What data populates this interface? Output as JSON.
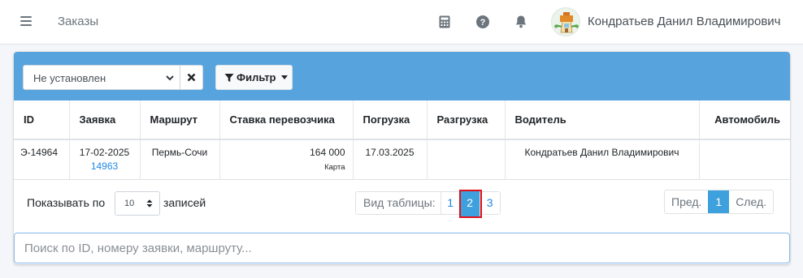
{
  "navbar": {
    "title": "Заказы",
    "user_name": "Кондратьев Данил Владимирович",
    "icons": [
      "menu-icon",
      "calculator-icon",
      "help-icon",
      "bell-icon"
    ]
  },
  "filters": {
    "status_value": "Не установлен",
    "filter_label": "Фильтр"
  },
  "table": {
    "columns": [
      "ID",
      "Заявка",
      "Маршрут",
      "Ставка перевозчика",
      "Погрузка",
      "Разгрузка",
      "Водитель",
      "Автомобиль"
    ],
    "rows": [
      {
        "id": "Э-14964",
        "date": "17-02-2025",
        "request_no": "14963",
        "route": "Пермь-Сочи",
        "rate": "164 000",
        "rate_type": "Карта",
        "loading": "17.03.2025",
        "unloading": "",
        "driver": "Кондратьев Данил Владимирович",
        "vehicle": ""
      }
    ]
  },
  "pager": {
    "per_page_label": "Показывать по",
    "per_page_value": "10",
    "per_page_suffix": "записей",
    "view_label": "Вид таблицы:",
    "views": [
      "1",
      "2",
      "3"
    ],
    "active_view": "2",
    "prev_label": "Пред.",
    "current_page": "1",
    "next_label": "След."
  },
  "search": {
    "placeholder": "Поиск по ID, номеру заявки, маршруту..."
  },
  "colors": {
    "header_blue": "#56a3de",
    "accent_blue": "#3ea0dc",
    "link_blue": "#1e88e5",
    "highlight_red": "#e0111b"
  }
}
